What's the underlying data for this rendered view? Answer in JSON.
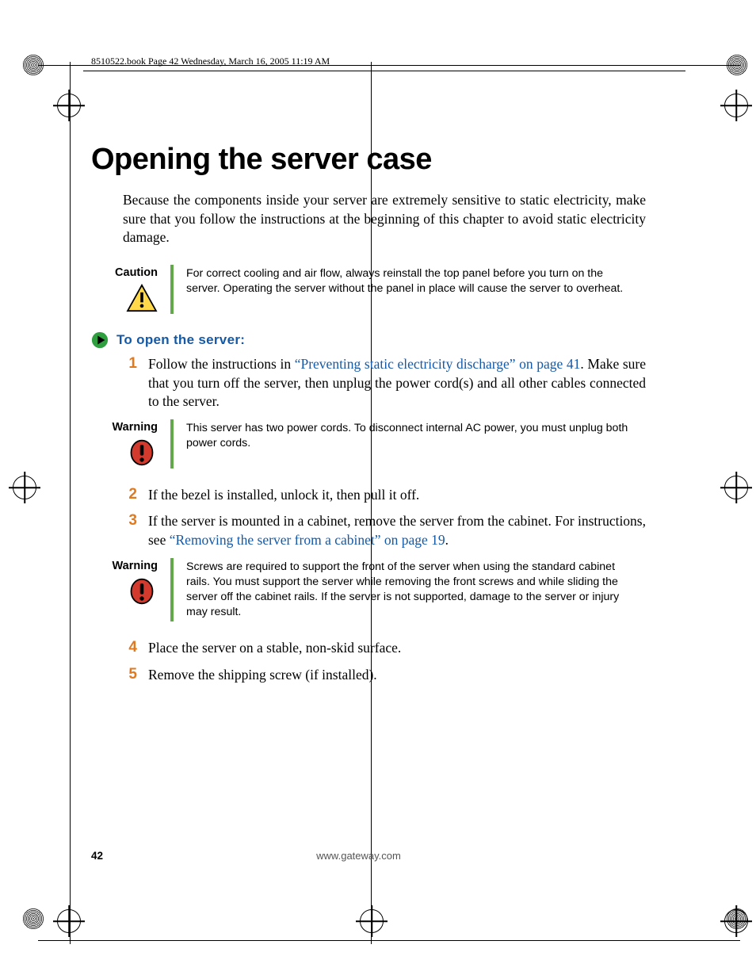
{
  "book_header": "8510522.book  Page 42  Wednesday, March 16, 2005  11:19 AM",
  "title": "Opening the server case",
  "intro": "Because the components inside your server are extremely sensitive to static electricity, make sure that you follow the instructions at the beginning of this chapter to avoid static electricity damage.",
  "callouts": {
    "caution": {
      "label": "Caution",
      "body": "For correct cooling and air flow, always reinstall the top panel before you turn on the server. Operating the server without the panel in place will cause the server to overheat."
    },
    "warning1": {
      "label": "Warning",
      "body": "This server has two power cords. To disconnect internal AC power, you must unplug both power cords."
    },
    "warning2": {
      "label": "Warning",
      "body": "Screws are required to support the front of the server when using the standard cabinet rails. You must support the server while removing the front screws and while sliding the server off the cabinet rails. If the server is not supported, damage to the server or injury may result."
    }
  },
  "procedure_title": "To open the server:",
  "steps": {
    "s1_a": "Follow the instructions in ",
    "s1_link": "“Preventing static electricity discharge” on page 41",
    "s1_b": ". Make sure that you turn off the server, then unplug the power cord(s) and all other cables connected to the server.",
    "s2": "If the bezel is installed, unlock it, then pull it off.",
    "s3_a": "If the server is mounted in a cabinet, remove the server from the cabinet. For instructions, see ",
    "s3_link": "“Removing the server from a cabinet” on page 19",
    "s3_b": ".",
    "s4": "Place the server on a stable, non-skid surface.",
    "s5": "Remove the shipping screw (if installed)."
  },
  "nums": {
    "n1": "1",
    "n2": "2",
    "n3": "3",
    "n4": "4",
    "n5": "5"
  },
  "footer": {
    "page": "42",
    "url": "www.gateway.com"
  }
}
